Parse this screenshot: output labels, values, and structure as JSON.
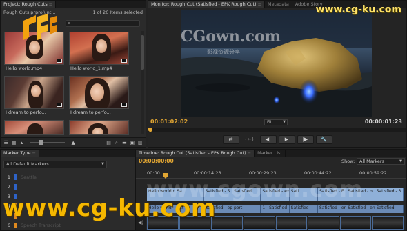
{
  "project": {
    "tab": "Project: Rough Cuts",
    "file": "Rough Cuts.prproj\\Int...",
    "count": "1 of 26 Items selected",
    "clips": [
      {
        "label": "Hello world.mp4"
      },
      {
        "label": "Hello world_1.mp4"
      },
      {
        "label": "I dream to perfo..."
      },
      {
        "label": "I dream to perfo..."
      },
      {
        "label": ""
      },
      {
        "label": ""
      }
    ]
  },
  "monitor": {
    "tabs": [
      "Monitor: Rough Cut (Satisfied - EPK Rough Cut)",
      "Metadata",
      "Adobe Story"
    ],
    "timecode_current": "00:01:02:02",
    "timecode_duration": "00:00:01:23",
    "zoom": "Fit",
    "transport": [
      "⇄",
      "{←}",
      "◀|",
      "▶",
      "|▶",
      "🔧"
    ]
  },
  "marker_panel": {
    "tab": "Marker Type",
    "filter": "All Default Markers",
    "rows": [
      {
        "num": "1",
        "name": "Seattle",
        "color": "#2e63c7"
      },
      {
        "num": "2",
        "name": "",
        "color": "#2e63c7"
      },
      {
        "num": "3",
        "name": "",
        "color": "#2e63c7"
      },
      {
        "num": "4",
        "name": "",
        "color": "#e08a1f"
      },
      {
        "num": "5",
        "name": "",
        "color": "#e08a1f"
      },
      {
        "num": "6",
        "name": "Speech Transcript",
        "color": "#e08a1f"
      }
    ]
  },
  "timeline": {
    "tabs": [
      "Timeline: Rough Cut (Satisfied - EPK Rough Cut)",
      "Marker List"
    ],
    "timecode": "00:00:00:00",
    "show_label": "Show:",
    "show_value": "All Markers",
    "ticks": [
      "00:00",
      "00:00:14:23",
      "00:00:29:23",
      "00:00:44:22",
      "00:00:59:22"
    ],
    "video_clips": [
      "Hello world.m",
      "Sa",
      "Satisfied - S",
      "Satisfied",
      "Satisfied - ex",
      "Sati",
      "Satisfied - E",
      "Satisfied - o",
      "Satisfied - 3"
    ],
    "audio_clips": [
      "Hello world",
      "Sat",
      "Satisfied - ep",
      "port",
      "1 - Satisfied",
      "Satisfied",
      "Satisfied - en",
      "Satisfied - end",
      "Satisfied"
    ]
  },
  "watermarks": {
    "top": "www.cg-ku.com",
    "cg_large": "CGown.com",
    "cg_small": "影视资源分享",
    "mid": "www.cgown.com",
    "bottom": "www.cg-ku.com"
  }
}
